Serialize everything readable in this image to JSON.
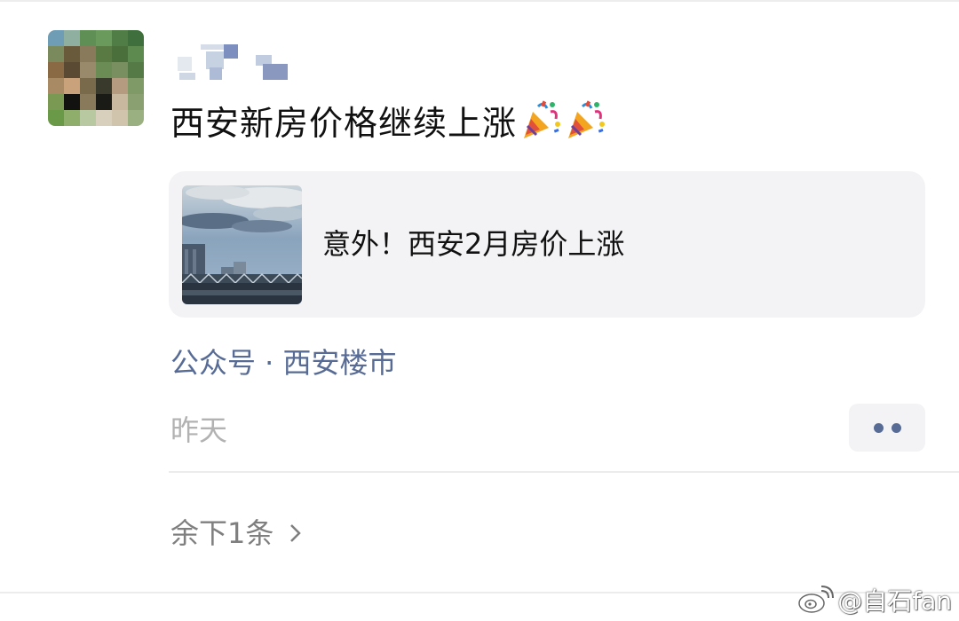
{
  "post": {
    "text": "西安新房价格继续上涨",
    "emojis": [
      "party-popper-icon",
      "party-popper-icon"
    ]
  },
  "link_card": {
    "title": "意外！西安2月房价上涨"
  },
  "source": "公众号 · 西安楼市",
  "time": "昨天",
  "remaining": "余下1条",
  "watermark": "@自石fan",
  "colors": {
    "link_blue": "#576b95",
    "time_gray": "#b2b2b2",
    "card_bg": "#f3f3f5"
  }
}
